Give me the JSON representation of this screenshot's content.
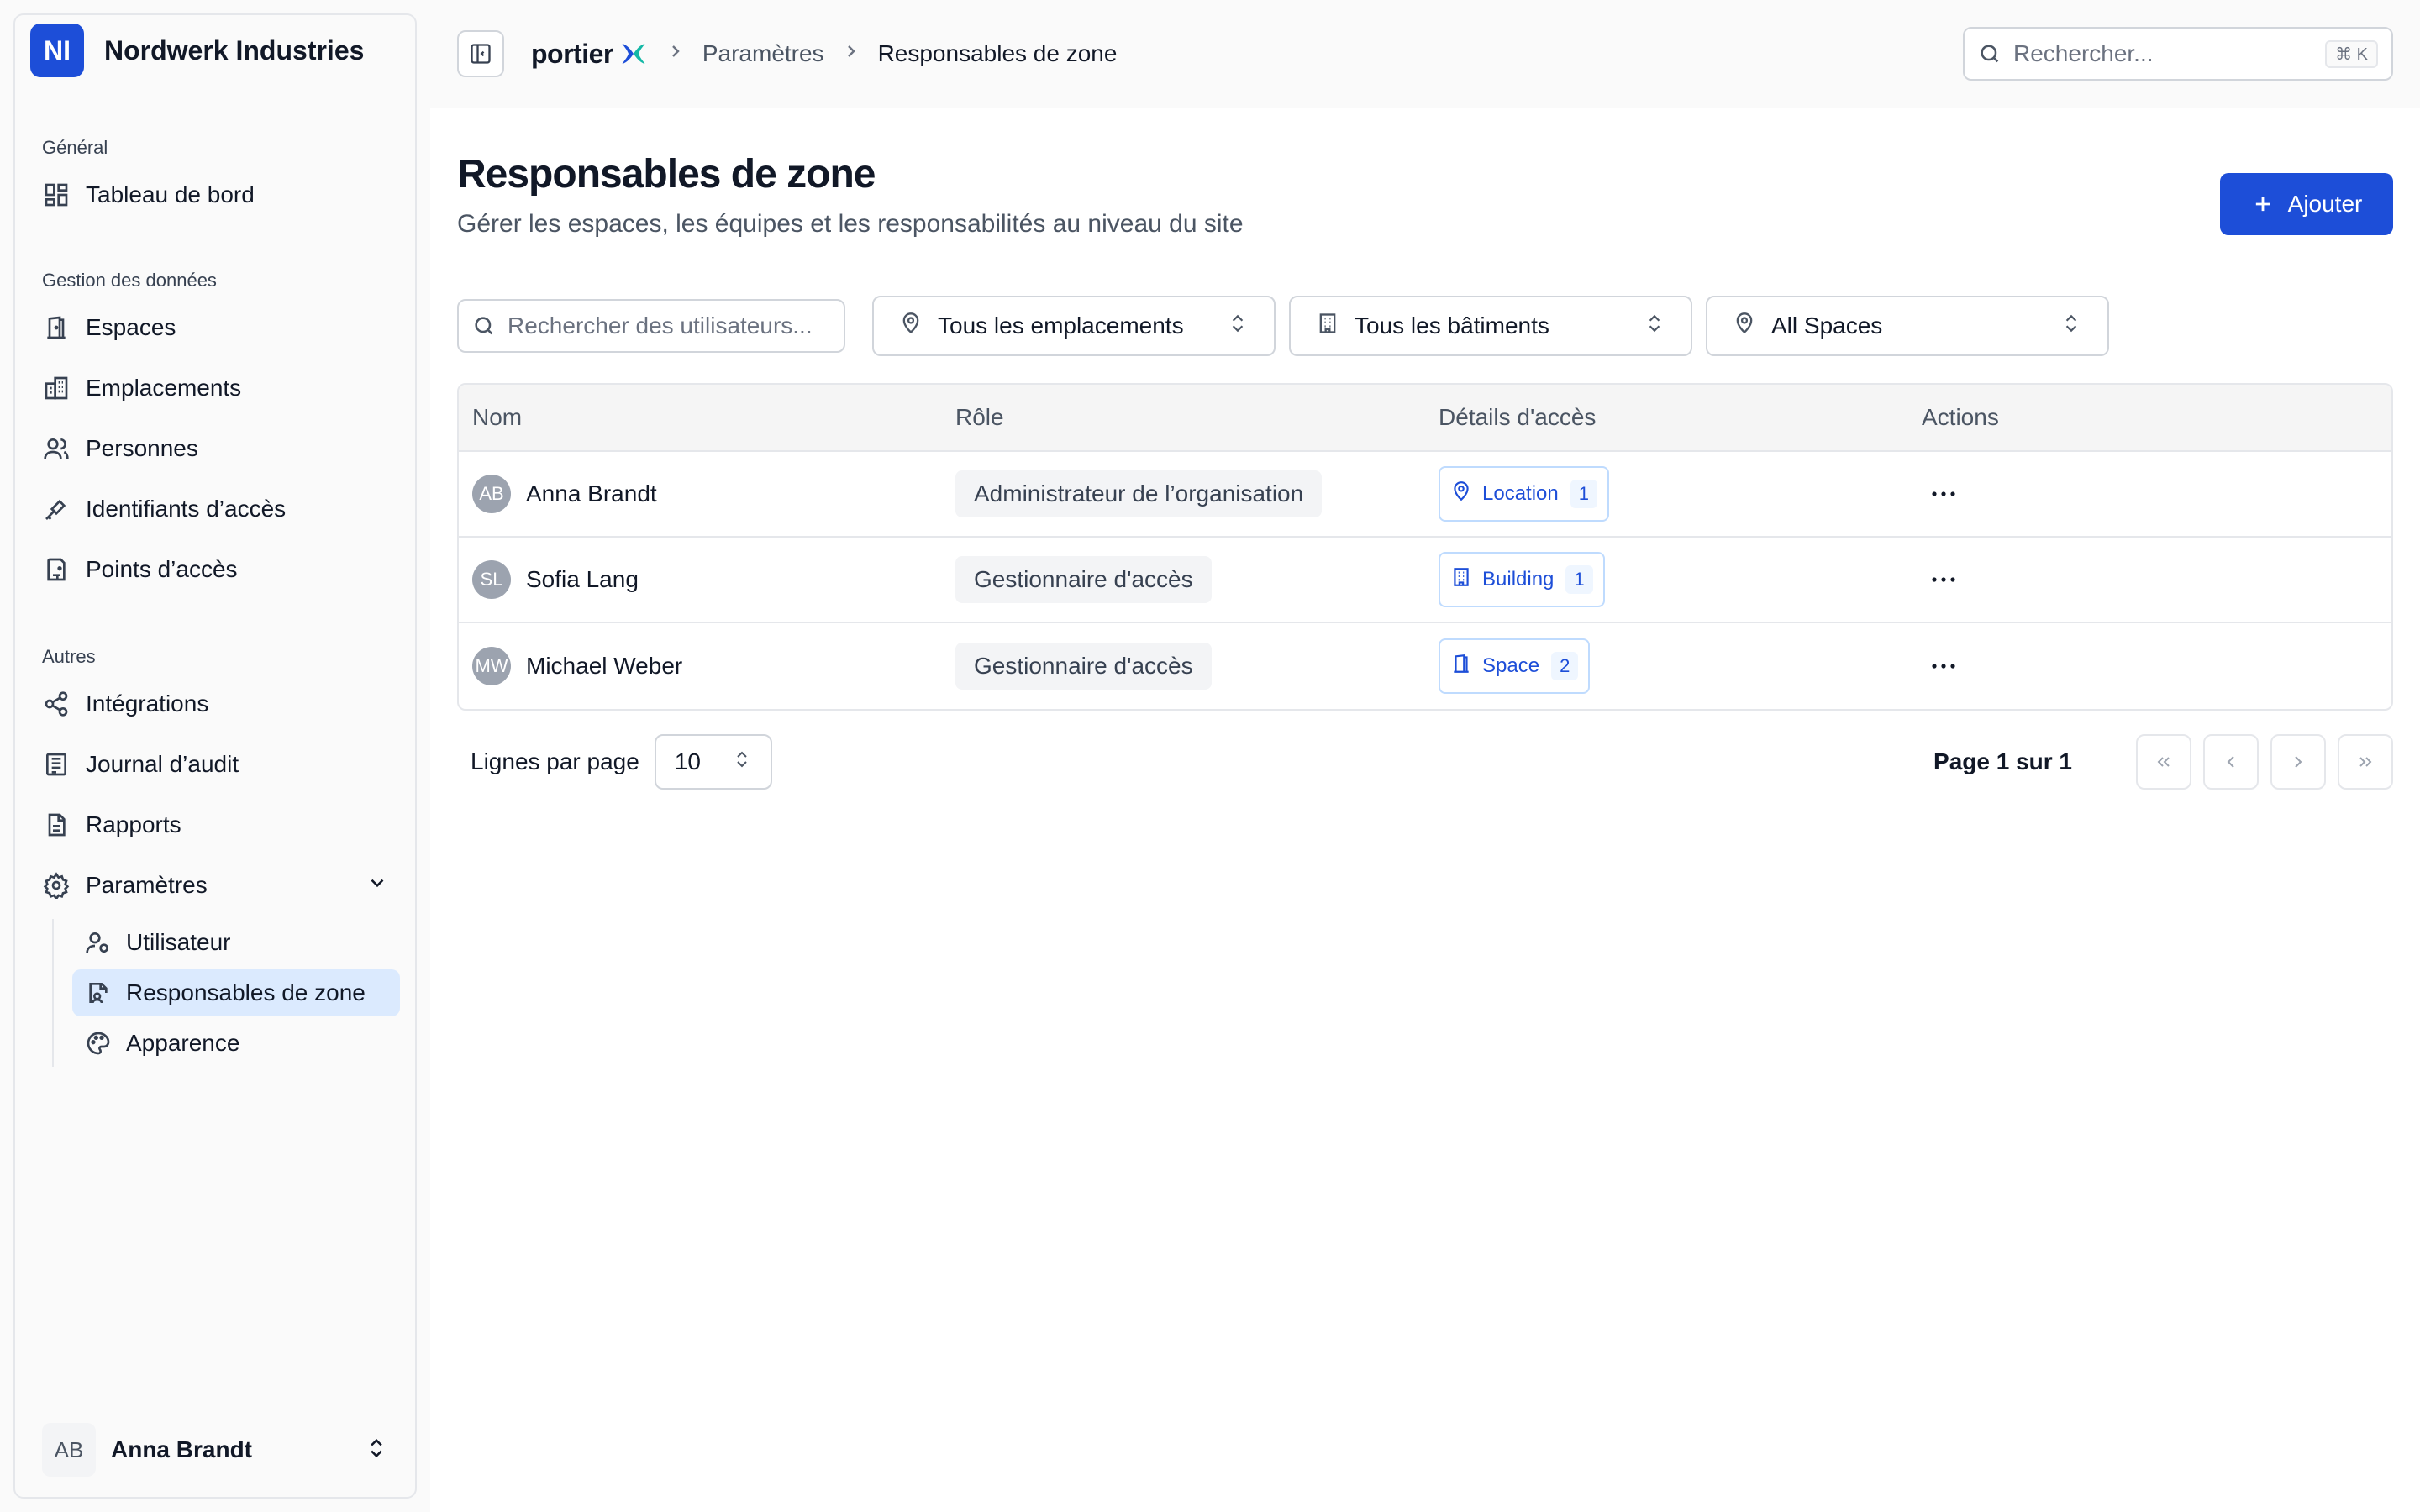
{
  "org": {
    "initials": "NI",
    "name": "Nordwerk Industries"
  },
  "sidebar": {
    "sections": [
      {
        "title": "Général",
        "items": [
          {
            "label": "Tableau de bord",
            "icon": "dashboard-icon"
          }
        ]
      },
      {
        "title": "Gestion des données",
        "items": [
          {
            "label": "Espaces",
            "icon": "door-icon"
          },
          {
            "label": "Emplacements",
            "icon": "buildings-icon"
          },
          {
            "label": "Personnes",
            "icon": "users-icon"
          },
          {
            "label": "Identifiants d’accès",
            "icon": "key-icon"
          },
          {
            "label": "Points d’accès",
            "icon": "access-point-icon"
          }
        ]
      },
      {
        "title": "Autres",
        "items": [
          {
            "label": "Intégrations",
            "icon": "share-icon"
          },
          {
            "label": "Journal d’audit",
            "icon": "log-icon"
          },
          {
            "label": "Rapports",
            "icon": "report-icon"
          },
          {
            "label": "Paramètres",
            "icon": "gear-icon"
          }
        ]
      }
    ],
    "settings_sub": [
      {
        "label": "Utilisateur",
        "icon": "user-gear-icon"
      },
      {
        "label": "Responsables de zone",
        "icon": "zone-manager-icon",
        "active": true
      },
      {
        "label": "Apparence",
        "icon": "palette-icon"
      }
    ],
    "user": {
      "initials": "AB",
      "name": "Anna Brandt"
    }
  },
  "topbar": {
    "brand": "portier",
    "breadcrumb": [
      "Paramètres",
      "Responsables de zone"
    ],
    "search_placeholder": "Rechercher...",
    "shortcut": "⌘ K"
  },
  "page": {
    "title": "Responsables de zone",
    "subtitle": "Gérer les espaces, les équipes et les responsabilités au niveau du site",
    "add_label": "Ajouter"
  },
  "filters": {
    "search_placeholder": "Rechercher des utilisateurs...",
    "location": "Tous les emplacements",
    "building": "Tous les bâtiments",
    "space": "All Spaces"
  },
  "table": {
    "headers": [
      "Nom",
      "Rôle",
      "Détails d'accès",
      "Actions"
    ],
    "rows": [
      {
        "initials": "AB",
        "name": "Anna Brandt",
        "role": "Administrateur de l’organisation",
        "access_type": "Location",
        "access_count": "1",
        "access_icon": "location-pin-icon"
      },
      {
        "initials": "SL",
        "name": "Sofia Lang",
        "role": "Gestionnaire d'accès",
        "access_type": "Building",
        "access_count": "1",
        "access_icon": "building-icon"
      },
      {
        "initials": "MW",
        "name": "Michael Weber",
        "role": "Gestionnaire d'accès",
        "access_type": "Space",
        "access_count": "2",
        "access_icon": "door-icon"
      }
    ]
  },
  "pagination": {
    "rows_per_page_label": "Lignes par page",
    "rows_per_page": "10",
    "page_info": "Page 1 sur 1"
  },
  "colors": {
    "accent": "#1d4ed8",
    "active_bg": "#dbeafe"
  }
}
